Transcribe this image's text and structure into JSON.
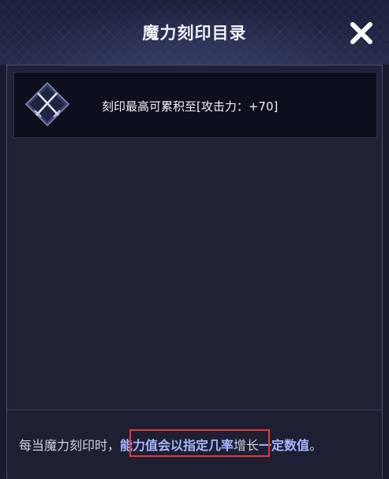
{
  "dialog": {
    "title": "魔力刻印目录",
    "close_icon": "close-icon"
  },
  "entries": [
    {
      "icon": "crossed-swords-icon",
      "text": "刻印最高可累积至[攻击力：+70]"
    }
  ],
  "footer": {
    "part1": "每当魔力刻印时，",
    "highlight1": "能力值会以指定几率",
    "part2": "增长",
    "highlight2": "一定数值",
    "part3": "。"
  },
  "colors": {
    "accent_text": "#a7b6ff",
    "highlight_box": "#e23a3a",
    "panel_bg": "#202135"
  }
}
